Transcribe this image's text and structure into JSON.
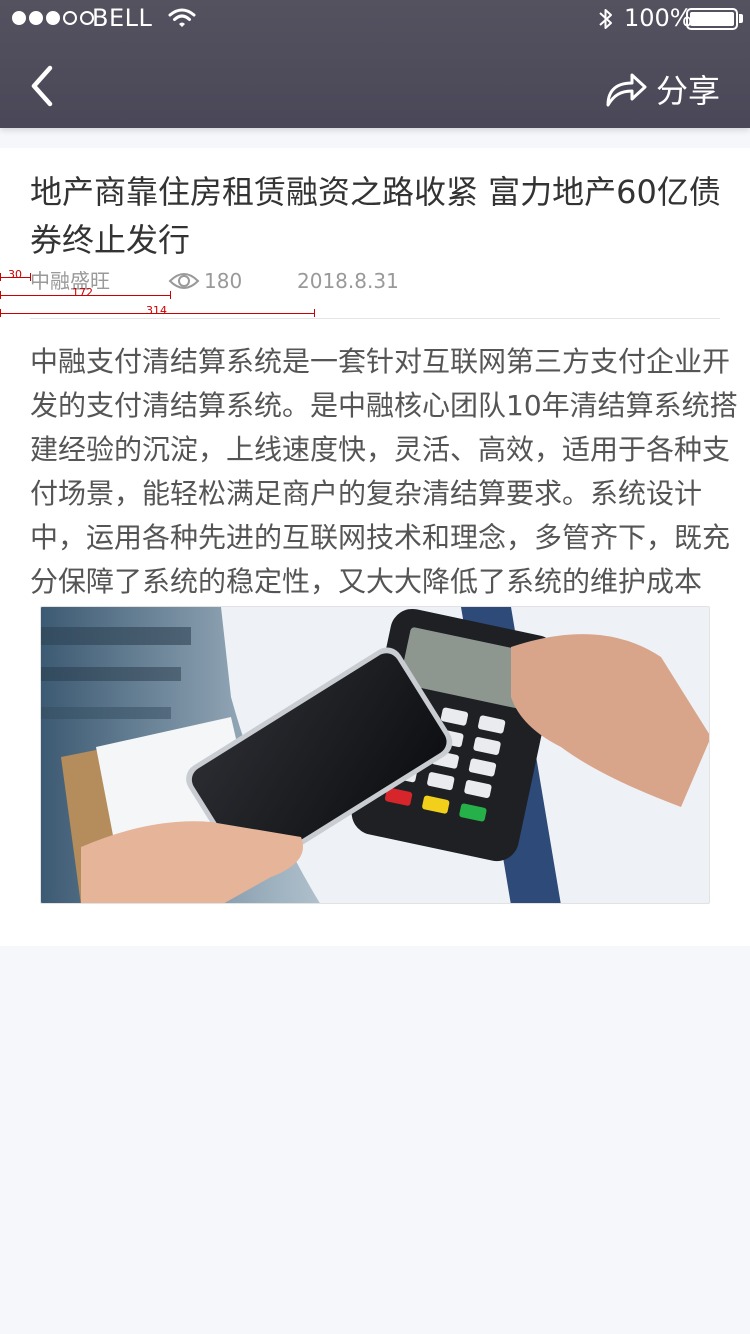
{
  "status_bar": {
    "carrier": "BELL",
    "battery": "100%"
  },
  "nav": {
    "back_icon": "chevron-left-icon",
    "share_icon": "share-icon",
    "share_label": "分享"
  },
  "article": {
    "title": "地产商靠住房租赁融资之路收紧 富力地产60亿债券终止发行",
    "source": "中融盛旺",
    "views": "180",
    "date": "2018.8.31",
    "body": "中融支付清结算系统是一套针对互联网第三方支付企业开发的支付清结算系统。是中融核心团队10年清结算系统搭建经验的沉淀，上线速度快，灵活、高效，适用于各种支付场景，能轻松满足商户的复杂清结算要求。系统设计中，运用各种先进的互联网技术和理念，多管齐下，既充分保障了系统的稳定性，又大大降低了系统的维护成本"
  },
  "dev_overlay": {
    "m1": "30",
    "m2": "172",
    "m3": "314"
  },
  "colors": {
    "header_bg": "#4f4d5b",
    "page_bg": "#f5f7fa",
    "title_text": "#333333",
    "meta_text": "#999999",
    "body_text": "#555555"
  }
}
